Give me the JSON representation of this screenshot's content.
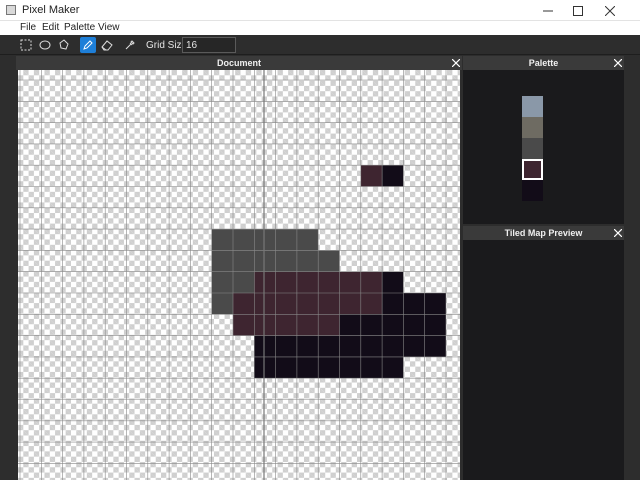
{
  "window": {
    "title": "Pixel Maker"
  },
  "menu": {
    "items": [
      "File",
      "Edit",
      "Palette",
      "View"
    ]
  },
  "toolbar": {
    "tools": [
      "rect-select-icon",
      "ellipse-select-icon",
      "lasso-icon",
      "pencil-icon",
      "eraser-icon",
      "eyedropper-icon"
    ],
    "active_tool": "pencil-icon",
    "grid_size_label": "Grid Size",
    "grid_size_value": "16"
  },
  "document": {
    "title": "Document"
  },
  "palette": {
    "title": "Palette",
    "swatches": [
      "#8a98a8",
      "#6e6b62",
      "#4a4a4a",
      "#3e2530",
      "#120c18"
    ],
    "selected_index": 3
  },
  "tiled_preview": {
    "title": "Tiled Map Preview"
  },
  "pixels": [
    {
      "c": 21,
      "r": 10,
      "w": 5,
      "h": 1,
      "color": "#4a4a4a"
    },
    {
      "c": 21,
      "r": 11,
      "w": 6,
      "h": 1,
      "color": "#4a4a4a"
    },
    {
      "c": 21,
      "r": 12,
      "w": 2,
      "h": 2,
      "color": "#4a4a4a"
    },
    {
      "c": 25,
      "r": 12,
      "w": 4,
      "h": 1,
      "color": "#3e2530"
    },
    {
      "c": 23,
      "r": 12,
      "w": 2,
      "h": 2,
      "color": "#3e2530"
    },
    {
      "c": 22,
      "r": 13,
      "w": 1,
      "h": 2,
      "color": "#3e2530"
    },
    {
      "c": 23,
      "r": 14,
      "w": 4,
      "h": 1,
      "color": "#3e2530"
    },
    {
      "c": 25,
      "r": 13,
      "w": 4,
      "h": 1,
      "color": "#3e2530"
    },
    {
      "c": 27,
      "r": 14,
      "w": 2,
      "h": 1,
      "color": "#120c18"
    },
    {
      "c": 29,
      "r": 12,
      "w": 1,
      "h": 2,
      "color": "#120c18"
    },
    {
      "c": 29,
      "r": 14,
      "w": 3,
      "h": 2,
      "color": "#120c18"
    },
    {
      "c": 30,
      "r": 13,
      "w": 2,
      "h": 1,
      "color": "#120c18"
    },
    {
      "c": 23,
      "r": 15,
      "w": 7,
      "h": 2,
      "color": "#120c18"
    },
    {
      "c": 28,
      "r": 7,
      "w": 1,
      "h": 1,
      "color": "#3e2530"
    },
    {
      "c": 29,
      "r": 7,
      "w": 1,
      "h": 1,
      "color": "#120c18"
    }
  ]
}
